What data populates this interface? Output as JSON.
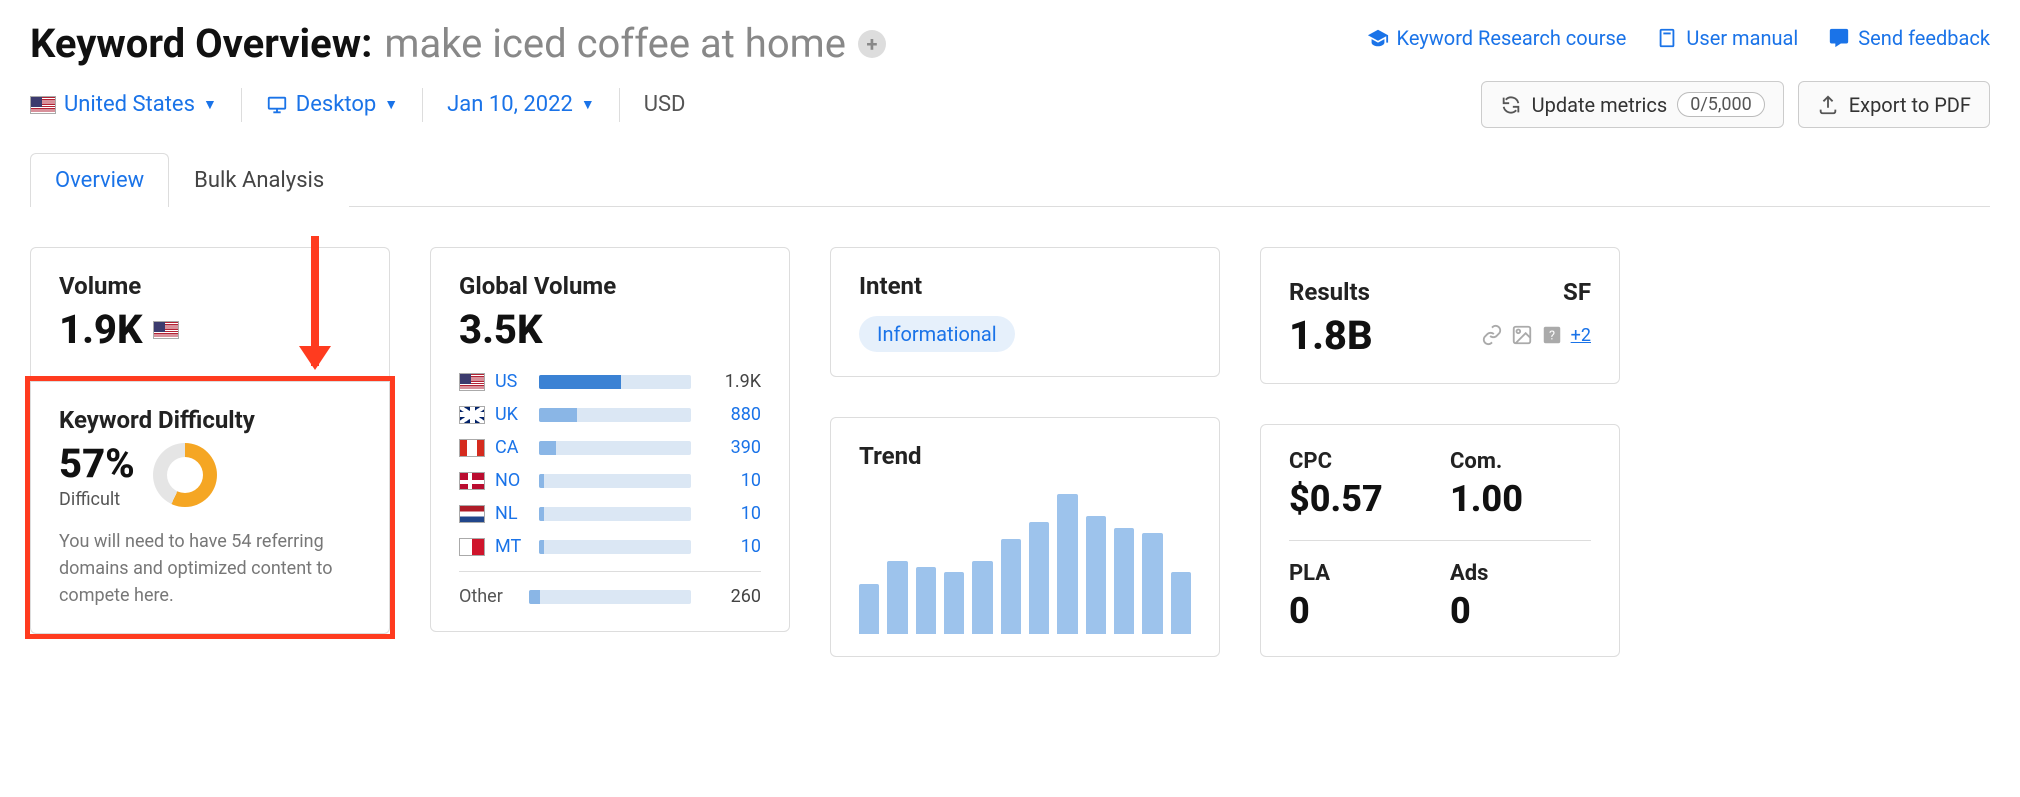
{
  "header": {
    "title_prefix": "Keyword Overview:",
    "keyword": "make iced coffee at home",
    "links": {
      "course": "Keyword Research course",
      "manual": "User manual",
      "feedback": "Send feedback"
    }
  },
  "filters": {
    "country": "United States",
    "device": "Desktop",
    "date": "Jan 10, 2022",
    "currency": "USD"
  },
  "actions": {
    "update": "Update metrics",
    "update_count": "0/5,000",
    "export": "Export to PDF"
  },
  "tabs": {
    "overview": "Overview",
    "bulk": "Bulk Analysis"
  },
  "volume": {
    "title": "Volume",
    "value": "1.9K"
  },
  "kd": {
    "title": "Keyword Difficulty",
    "value": "57%",
    "label": "Difficult",
    "desc": "You will need to have 54 referring domains and optimized content to compete here."
  },
  "global_volume": {
    "title": "Global Volume",
    "value": "3.5K",
    "rows": [
      {
        "flag": "us",
        "code": "US",
        "val": "1.9K",
        "pct": 54,
        "link": false,
        "first": true
      },
      {
        "flag": "uk",
        "code": "UK",
        "val": "880",
        "pct": 25,
        "link": true
      },
      {
        "flag": "ca",
        "code": "CA",
        "val": "390",
        "pct": 11,
        "link": true
      },
      {
        "flag": "no",
        "code": "NO",
        "val": "10",
        "pct": 3,
        "link": true
      },
      {
        "flag": "nl",
        "code": "NL",
        "val": "10",
        "pct": 3,
        "link": true
      },
      {
        "flag": "mt",
        "code": "MT",
        "val": "10",
        "pct": 3,
        "link": true
      }
    ],
    "other_label": "Other",
    "other_val": "260",
    "other_pct": 7
  },
  "intent": {
    "title": "Intent",
    "badge": "Informational"
  },
  "trend": {
    "title": "Trend"
  },
  "results": {
    "title": "Results",
    "value": "1.8B",
    "sf_title": "SF",
    "sf_more": "+2"
  },
  "cpc": {
    "cpc_label": "CPC",
    "cpc_value": "$0.57",
    "com_label": "Com.",
    "com_value": "1.00",
    "pla_label": "PLA",
    "pla_value": "0",
    "ads_label": "Ads",
    "ads_value": "0"
  },
  "chart_data": {
    "type": "bar",
    "title": "Trend",
    "bars": [
      36,
      52,
      48,
      44,
      52,
      68,
      80,
      100,
      84,
      76,
      72,
      44
    ],
    "ylim": [
      0,
      100
    ]
  }
}
